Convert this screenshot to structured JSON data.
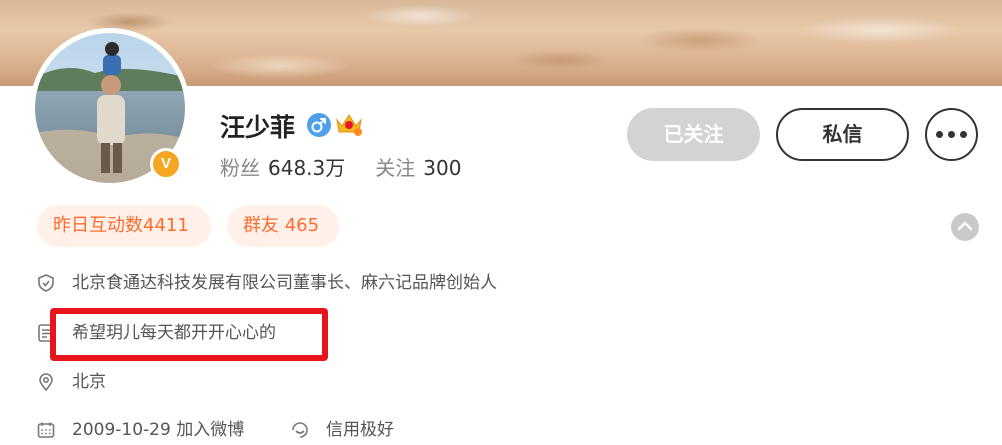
{
  "profile": {
    "name": "汪少菲",
    "verified_badge": "V",
    "stats": {
      "followers_label": "粉丝",
      "followers_value": "648.3万",
      "following_label": "关注",
      "following_value": "300"
    }
  },
  "actions": {
    "followed_label": "已关注",
    "message_label": "私信"
  },
  "tags": {
    "interactions": "昨日互动数4411",
    "group": "群友 465"
  },
  "details": {
    "company": "北京食通达科技发展有限公司董事长、麻六记品牌创始人",
    "bio": "希望玥儿每天都开开心心的",
    "location": "北京",
    "joined": "2009-10-29 加入微博",
    "credit": "信用极好"
  },
  "colors": {
    "accent_orange": "#ff6d2e",
    "highlight_red": "#e8141c",
    "verified_gold": "#f5a623",
    "gender_blue": "#4ea1e8"
  },
  "icons": [
    "shield-icon",
    "document-icon",
    "location-icon",
    "calendar-icon",
    "credit-icon",
    "male-icon",
    "crown-icon",
    "chevron-up-icon",
    "more-icon"
  ]
}
